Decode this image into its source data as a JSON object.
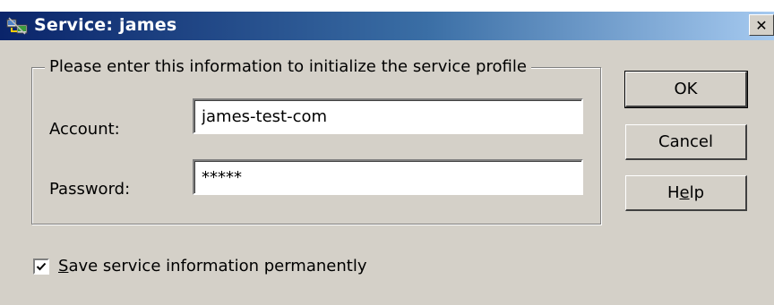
{
  "window": {
    "title": "Service: james",
    "close_symbol": "✕"
  },
  "group": {
    "legend": "Please enter this information to initialize the service profile"
  },
  "fields": {
    "account_label": "Account:",
    "account_value": "james-test-com",
    "password_label": "Password:",
    "password_value": "*****"
  },
  "buttons": {
    "ok": "OK",
    "cancel": "Cancel",
    "help_pre": "H",
    "help_mnemonic": "e",
    "help_post": "lp"
  },
  "checkbox": {
    "checked": true,
    "label_mnemonic": "S",
    "label_rest": "ave service information permanently"
  },
  "icons": [
    "network-service-icon",
    "close-icon",
    "checkmark-icon"
  ],
  "colors": {
    "titlebar_start": "#0a246a",
    "titlebar_end": "#a6caf0",
    "dialog_face": "#d4d0c8"
  }
}
